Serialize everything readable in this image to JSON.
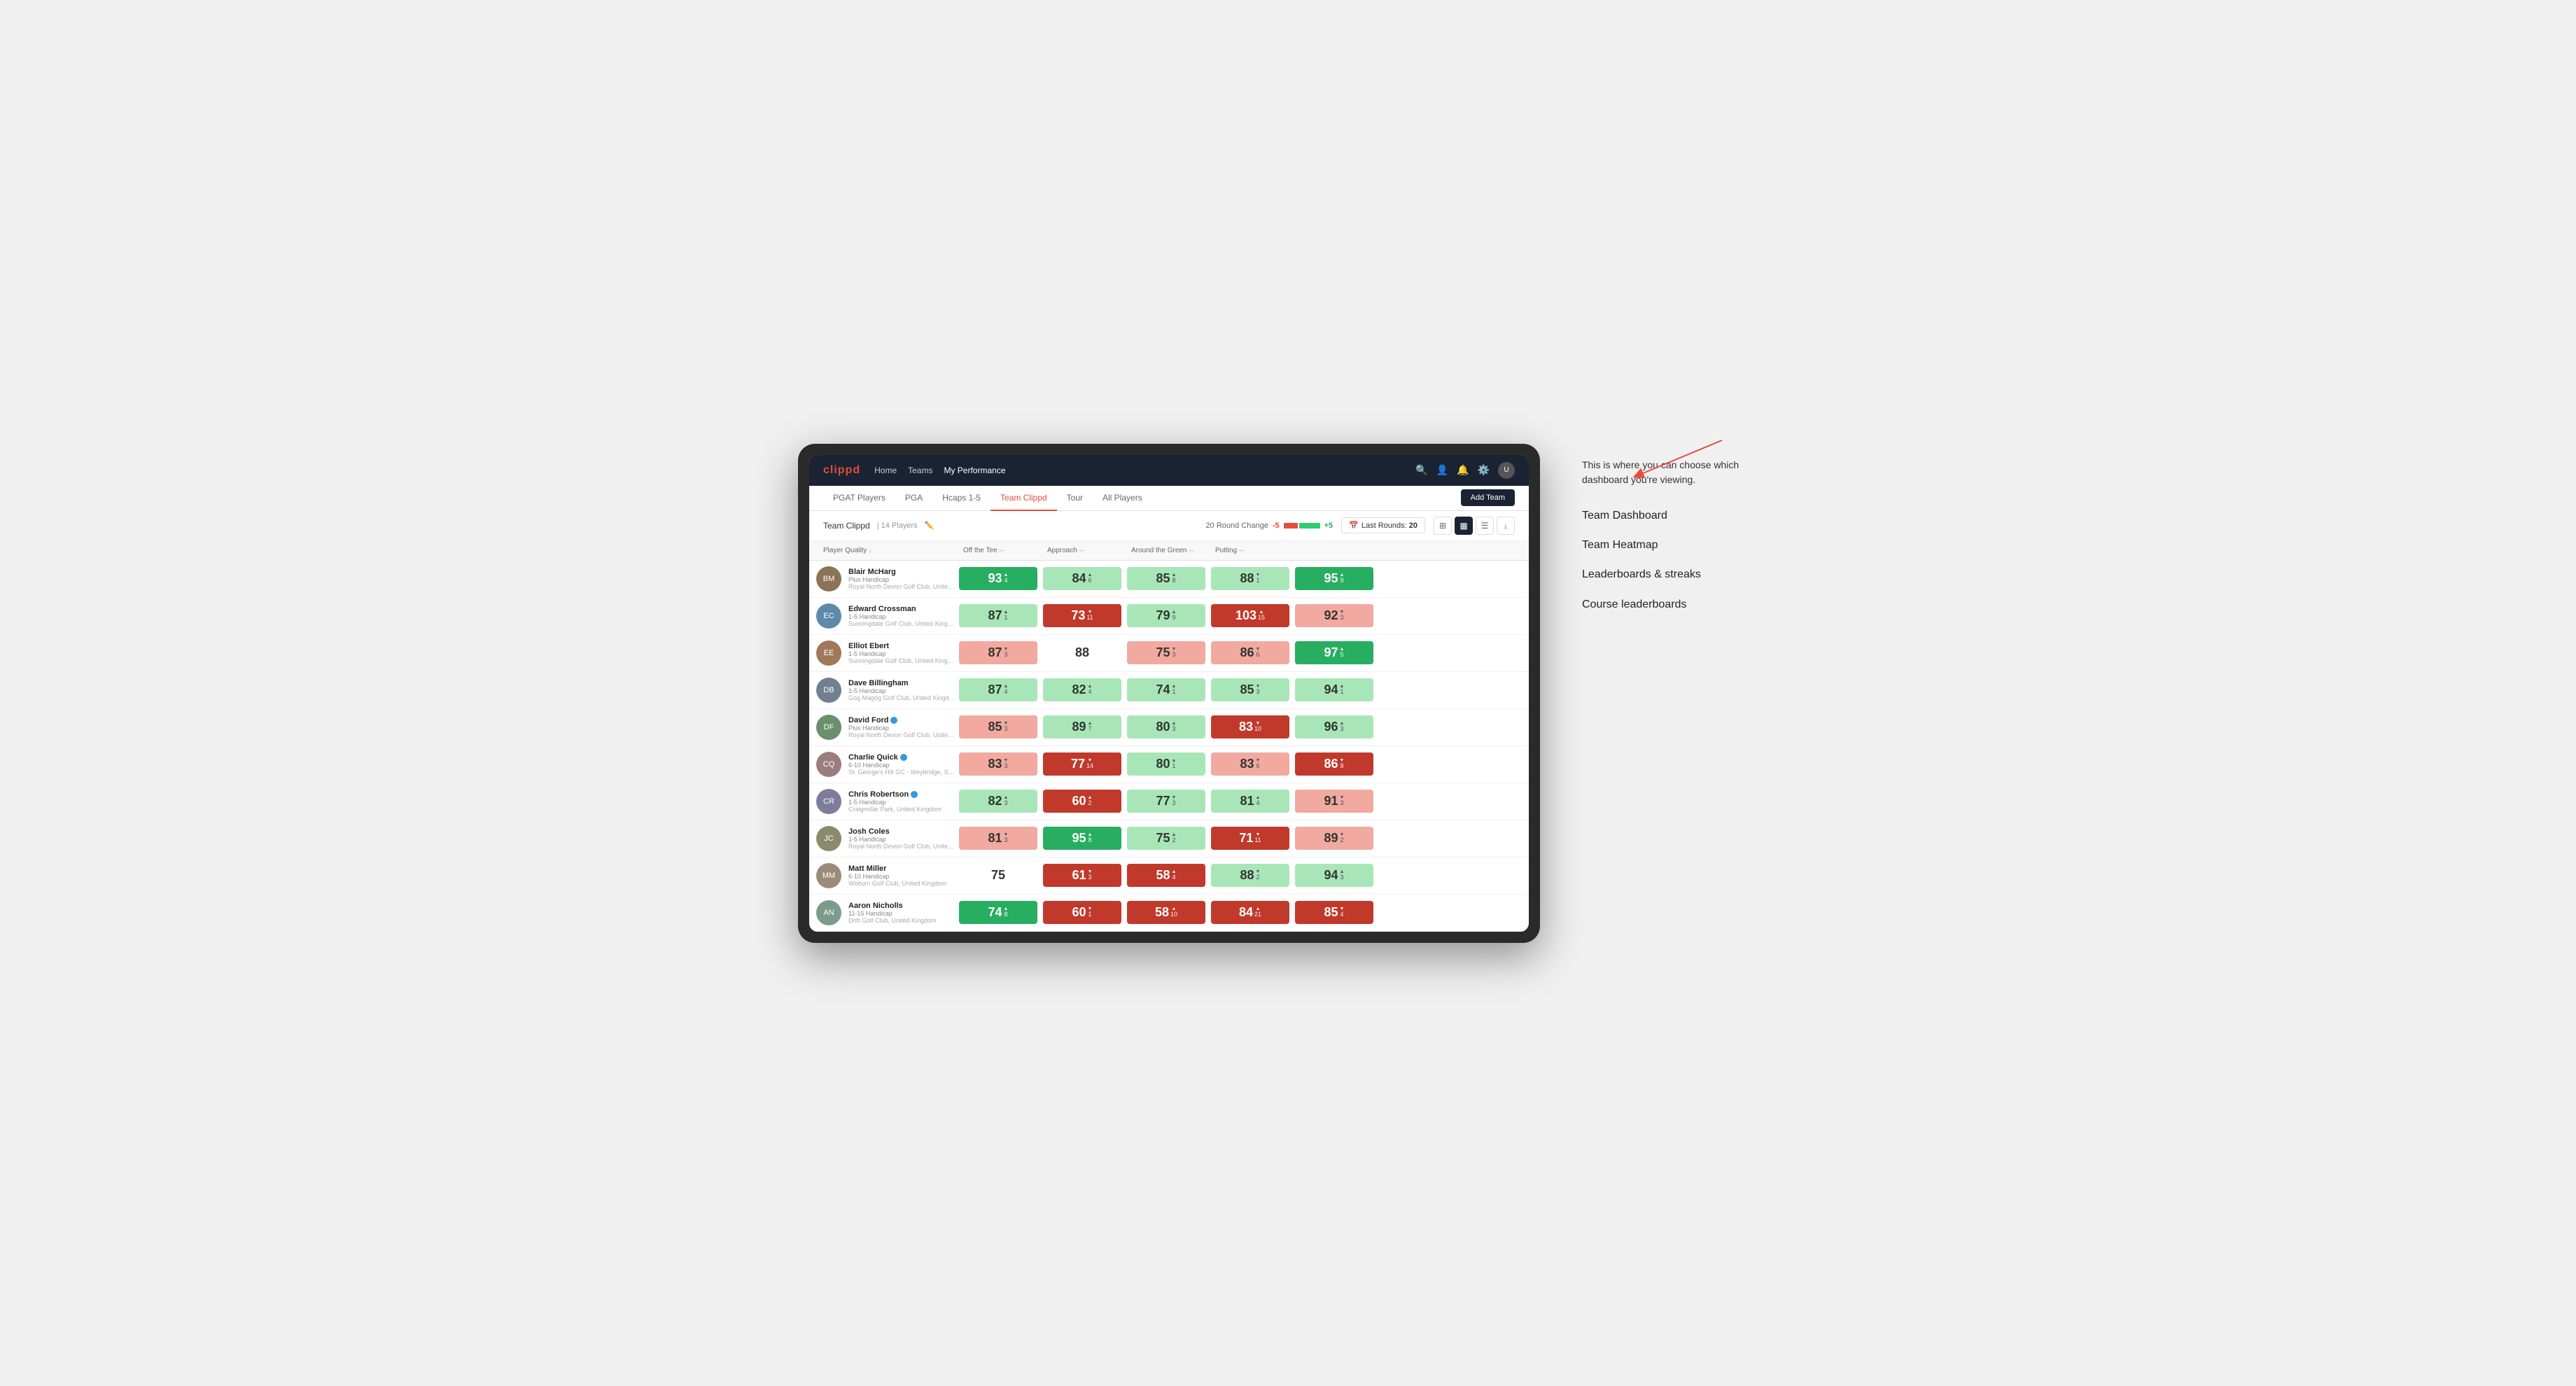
{
  "annotation": {
    "intro": "This is where you can choose which dashboard you're viewing.",
    "items": [
      "Team Dashboard",
      "Team Heatmap",
      "Leaderboards & streaks",
      "Course leaderboards"
    ]
  },
  "nav": {
    "logo": "clippd",
    "links": [
      "Home",
      "Teams",
      "My Performance"
    ],
    "active_link": "My Performance"
  },
  "tabs": {
    "items": [
      "PGAT Players",
      "PGA",
      "Hcaps 1-5",
      "Team Clippd",
      "Tour",
      "All Players"
    ],
    "active": "Team Clippd",
    "add_btn": "Add Team"
  },
  "sub_header": {
    "team_name": "Team Clippd",
    "separator": "|",
    "count": "14 Players",
    "round_change_label": "20 Round Change",
    "round_change_neg": "-5",
    "round_change_pos": "+5",
    "last_rounds_label": "Last Rounds:",
    "last_rounds_value": "20"
  },
  "table": {
    "columns": [
      "Player Quality ↓",
      "Off the Tee —",
      "Approach —",
      "Around the Green —",
      "Putting —"
    ],
    "players": [
      {
        "name": "Blair McHarg",
        "hcp": "Plus Handicap",
        "club": "Royal North Devon Golf Club, United Kingdom",
        "scores": [
          {
            "value": "93",
            "delta": "4",
            "dir": "up",
            "color": "green-dark"
          },
          {
            "value": "84",
            "delta": "6",
            "dir": "up",
            "color": "green-light"
          },
          {
            "value": "85",
            "delta": "8",
            "dir": "up",
            "color": "green-light"
          },
          {
            "value": "88",
            "delta": "1",
            "dir": "down",
            "color": "green-light"
          },
          {
            "value": "95",
            "delta": "9",
            "dir": "up",
            "color": "green-dark"
          }
        ],
        "avatar_color": "player-avatar-1"
      },
      {
        "name": "Edward Crossman",
        "hcp": "1-5 Handicap",
        "club": "Sunningdale Golf Club, United Kingdom",
        "scores": [
          {
            "value": "87",
            "delta": "1",
            "dir": "up",
            "color": "green-light"
          },
          {
            "value": "73",
            "delta": "11",
            "dir": "down",
            "color": "red-dark"
          },
          {
            "value": "79",
            "delta": "9",
            "dir": "up",
            "color": "green-light"
          },
          {
            "value": "103",
            "delta": "15",
            "dir": "up",
            "color": "red-dark"
          },
          {
            "value": "92",
            "delta": "3",
            "dir": "down",
            "color": "red-light"
          }
        ],
        "avatar_color": "player-avatar-2"
      },
      {
        "name": "Elliot Ebert",
        "hcp": "1-5 Handicap",
        "club": "Sunningdale Golf Club, United Kingdom",
        "scores": [
          {
            "value": "87",
            "delta": "3",
            "dir": "down",
            "color": "red-light"
          },
          {
            "value": "88",
            "delta": "",
            "dir": "",
            "color": "white"
          },
          {
            "value": "75",
            "delta": "3",
            "dir": "down",
            "color": "red-light"
          },
          {
            "value": "86",
            "delta": "6",
            "dir": "down",
            "color": "red-light"
          },
          {
            "value": "97",
            "delta": "5",
            "dir": "up",
            "color": "green-dark"
          }
        ],
        "avatar_color": "player-avatar-3"
      },
      {
        "name": "Dave Billingham",
        "hcp": "1-5 Handicap",
        "club": "Gog Magog Golf Club, United Kingdom",
        "scores": [
          {
            "value": "87",
            "delta": "4",
            "dir": "up",
            "color": "green-light"
          },
          {
            "value": "82",
            "delta": "4",
            "dir": "up",
            "color": "green-light"
          },
          {
            "value": "74",
            "delta": "1",
            "dir": "up",
            "color": "green-light"
          },
          {
            "value": "85",
            "delta": "3",
            "dir": "down",
            "color": "green-light"
          },
          {
            "value": "94",
            "delta": "1",
            "dir": "up",
            "color": "green-light"
          }
        ],
        "avatar_color": "player-avatar-4"
      },
      {
        "name": "David Ford",
        "hcp": "Plus Handicap",
        "club": "Royal North Devon Golf Club, United Kingdom",
        "verified": true,
        "scores": [
          {
            "value": "85",
            "delta": "3",
            "dir": "down",
            "color": "red-light"
          },
          {
            "value": "89",
            "delta": "7",
            "dir": "up",
            "color": "green-light"
          },
          {
            "value": "80",
            "delta": "3",
            "dir": "up",
            "color": "green-light"
          },
          {
            "value": "83",
            "delta": "10",
            "dir": "down",
            "color": "red-dark"
          },
          {
            "value": "96",
            "delta": "3",
            "dir": "up",
            "color": "green-light"
          }
        ],
        "avatar_color": "player-avatar-5"
      },
      {
        "name": "Charlie Quick",
        "hcp": "6-10 Handicap",
        "club": "St. George's Hill GC - Weybridge, Surrey, Uni...",
        "verified": true,
        "scores": [
          {
            "value": "83",
            "delta": "3",
            "dir": "down",
            "color": "red-light"
          },
          {
            "value": "77",
            "delta": "14",
            "dir": "down",
            "color": "red-dark"
          },
          {
            "value": "80",
            "delta": "1",
            "dir": "up",
            "color": "green-light"
          },
          {
            "value": "83",
            "delta": "6",
            "dir": "down",
            "color": "red-light"
          },
          {
            "value": "86",
            "delta": "8",
            "dir": "down",
            "color": "red-dark"
          }
        ],
        "avatar_color": "player-avatar-6"
      },
      {
        "name": "Chris Robertson",
        "hcp": "1-5 Handicap",
        "club": "Craigmillar Park, United Kingdom",
        "verified": true,
        "scores": [
          {
            "value": "82",
            "delta": "3",
            "dir": "up",
            "color": "green-light"
          },
          {
            "value": "60",
            "delta": "2",
            "dir": "up",
            "color": "red-dark"
          },
          {
            "value": "77",
            "delta": "3",
            "dir": "down",
            "color": "green-light"
          },
          {
            "value": "81",
            "delta": "4",
            "dir": "up",
            "color": "green-light"
          },
          {
            "value": "91",
            "delta": "3",
            "dir": "down",
            "color": "red-light"
          }
        ],
        "avatar_color": "player-avatar-7"
      },
      {
        "name": "Josh Coles",
        "hcp": "1-5 Handicap",
        "club": "Royal North Devon Golf Club, United Kingdom",
        "scores": [
          {
            "value": "81",
            "delta": "3",
            "dir": "down",
            "color": "red-light"
          },
          {
            "value": "95",
            "delta": "8",
            "dir": "up",
            "color": "green-dark"
          },
          {
            "value": "75",
            "delta": "2",
            "dir": "up",
            "color": "green-light"
          },
          {
            "value": "71",
            "delta": "11",
            "dir": "down",
            "color": "red-dark"
          },
          {
            "value": "89",
            "delta": "2",
            "dir": "down",
            "color": "red-light"
          }
        ],
        "avatar_color": "player-avatar-8"
      },
      {
        "name": "Matt Miller",
        "hcp": "6-10 Handicap",
        "club": "Woburn Golf Club, United Kingdom",
        "scores": [
          {
            "value": "75",
            "delta": "",
            "dir": "",
            "color": "white"
          },
          {
            "value": "61",
            "delta": "3",
            "dir": "down",
            "color": "red-dark"
          },
          {
            "value": "58",
            "delta": "4",
            "dir": "up",
            "color": "red-dark"
          },
          {
            "value": "88",
            "delta": "2",
            "dir": "down",
            "color": "green-light"
          },
          {
            "value": "94",
            "delta": "3",
            "dir": "up",
            "color": "green-light"
          }
        ],
        "avatar_color": "player-avatar-9"
      },
      {
        "name": "Aaron Nicholls",
        "hcp": "11-15 Handicap",
        "club": "Drift Golf Club, United Kingdom",
        "scores": [
          {
            "value": "74",
            "delta": "8",
            "dir": "up",
            "color": "green-dark"
          },
          {
            "value": "60",
            "delta": "1",
            "dir": "down",
            "color": "red-dark"
          },
          {
            "value": "58",
            "delta": "10",
            "dir": "up",
            "color": "red-dark"
          },
          {
            "value": "84",
            "delta": "21",
            "dir": "up",
            "color": "red-dark"
          },
          {
            "value": "85",
            "delta": "4",
            "dir": "down",
            "color": "red-dark"
          }
        ],
        "avatar_color": "player-avatar-10"
      }
    ]
  }
}
